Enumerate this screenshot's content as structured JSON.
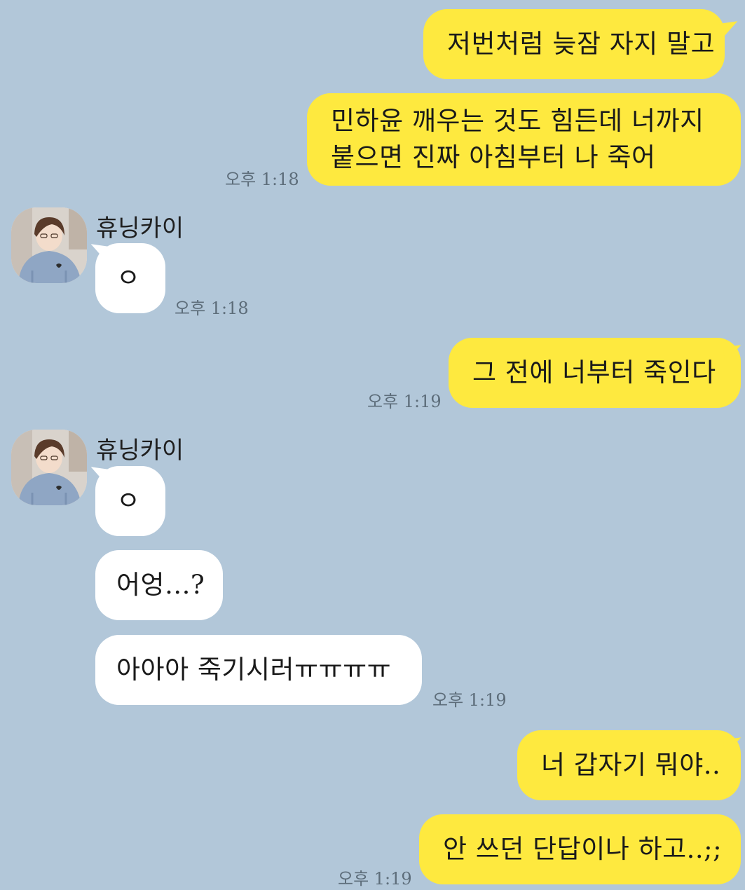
{
  "chat": {
    "contact_name": "휴닝카이",
    "messages": [
      {
        "from": "me",
        "text": "저번처럼 늦잠 자지 말고"
      },
      {
        "from": "me",
        "lines": [
          "민하윤 깨우는 것도 힘든데 너까지",
          "붙으면 진짜 아침부터 나 죽어"
        ],
        "time": "오후 1:18"
      },
      {
        "from": "them",
        "sender": "휴닝카이",
        "text": "ㅇ",
        "time": "오후 1:18"
      },
      {
        "from": "me",
        "text": "그 전에 너부터 죽인다",
        "time": "오후 1:19"
      },
      {
        "from": "them",
        "sender": "휴닝카이",
        "text": "ㅇ"
      },
      {
        "from": "them",
        "text": "어엉...?"
      },
      {
        "from": "them",
        "text": "아아아 죽기시러ㅠㅠㅠㅠ",
        "time": "오후 1:19"
      },
      {
        "from": "me",
        "text": "너 갑자기 뭐야.."
      },
      {
        "from": "me",
        "text": "안 쓰던 단답이나 하고..;;",
        "time": "오후 1:19"
      }
    ]
  },
  "colors": {
    "background": "#b2c7d9",
    "my_bubble": "#fee93f",
    "their_bubble": "#ffffff",
    "timestamp": "#5d6d7a"
  },
  "icons": {
    "avatar": "profile-photo-avatar"
  }
}
